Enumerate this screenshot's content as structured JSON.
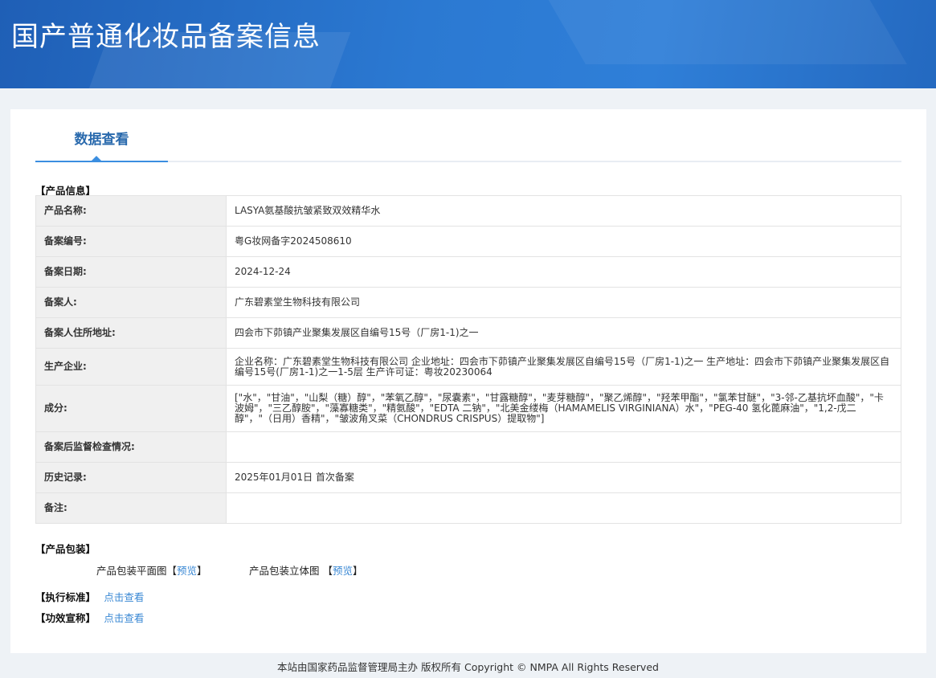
{
  "header": {
    "title": "国产普通化妆品备案信息"
  },
  "tab": {
    "label": "数据查看"
  },
  "sections": {
    "product_info": "【产品信息】",
    "packaging": "【产品包装】",
    "standard": "【执行标准】",
    "efficacy": "【功效宣称】"
  },
  "rows": [
    {
      "label": "产品名称:",
      "value": "LASYA氨基酸抗皱紧致双效精华水"
    },
    {
      "label": "备案编号:",
      "value": "粤G妆网备字2024508610"
    },
    {
      "label": "备案日期:",
      "value": "2024-12-24"
    },
    {
      "label": "备案人:",
      "value": "广东碧素堂生物科技有限公司"
    },
    {
      "label": "备案人住所地址:",
      "value": "四会市下茆镇产业聚集发展区自编号15号（厂房1-1)之一"
    },
    {
      "label": "生产企业:",
      "value": "企业名称：广东碧素堂生物科技有限公司 企业地址：四会市下茆镇产业聚集发展区自编号15号（厂房1-1)之一 生产地址：四会市下茆镇产业聚集发展区自编号15号(厂房1-1)之一1-5层 生产许可证：粤妆20230064"
    },
    {
      "label": "成分:",
      "value": "[\"水\"，\"甘油\"，\"山梨（糖）醇\"，\"苯氧乙醇\"，\"尿囊素\"，\"甘露糖醇\"，\"麦芽糖醇\"，\"聚乙烯醇\"，\"羟苯甲酯\"，\"氯苯甘醚\"，\"3-邻-乙基抗坏血酸\"，\"卡波姆\"，\"三乙醇胺\"，\"藻寡糖类\"，\"精氨酸\"，\"EDTA 二钠\"，\"北美金缕梅（HAMAMELIS VIRGINIANA）水\"，\"PEG-40 氢化蓖麻油\"，\"1,2-戊二醇\"，\"（日用）香精\"，\"皱波角叉菜（CHONDRUS CRISPUS）提取物\"]"
    },
    {
      "label": "备案后监督检查情况:",
      "value": ""
    },
    {
      "label": "历史记录:",
      "value": "2025年01月01日 首次备案"
    },
    {
      "label": "备注:",
      "value": ""
    }
  ],
  "packaging": {
    "flat_label": "产品包装平面图",
    "solid_label": "产品包装立体图",
    "open_bracket": "【",
    "close_bracket": "】",
    "preview": "预览"
  },
  "links": {
    "view": "点击查看"
  },
  "footer": {
    "text": "本站由国家药品监督管理局主办 版权所有 Copyright © NMPA All Rights Reserved"
  }
}
